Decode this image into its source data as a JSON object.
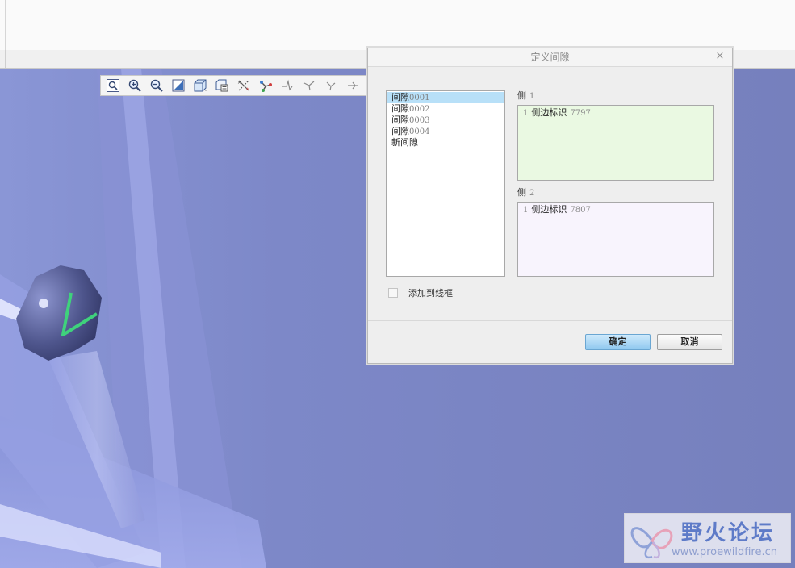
{
  "dialog": {
    "title": "定义间隙",
    "close_glyph": "×",
    "clearances": [
      {
        "prefix": "间隙",
        "num": "0001",
        "selected": true
      },
      {
        "prefix": "间隙",
        "num": "0002",
        "selected": false
      },
      {
        "prefix": "间隙",
        "num": "0003",
        "selected": false
      },
      {
        "prefix": "间隙",
        "num": "0004",
        "selected": false
      },
      {
        "prefix": "新间隙",
        "num": "",
        "selected": false
      }
    ],
    "side1": {
      "label": "侧",
      "num": "1",
      "entry_index": "1",
      "entry_text": "侧边标识",
      "entry_ref": "7797"
    },
    "side2": {
      "label": "侧",
      "num": "2",
      "entry_index": "1",
      "entry_text": "侧边标识",
      "entry_ref": "7807"
    },
    "checkbox_label": "添加到线框",
    "checkbox_checked": false,
    "ok_label": "确定",
    "cancel_label": "取消"
  },
  "toolbar": {
    "icons": [
      "zoom-fit-icon",
      "zoom-in-icon",
      "zoom-out-icon",
      "repaint-icon",
      "display-style-icon",
      "saved-views-icon",
      "datum-display-icon",
      "spin-center-icon",
      "annotation-1-icon",
      "annotation-2-icon",
      "annotation-3-icon",
      "annotation-4-icon"
    ]
  },
  "watermark": {
    "title": "野火论坛",
    "url": "www.proewildfire.cn"
  },
  "colors": {
    "viewport_bg": "#7680bd",
    "accent_blue": "#5e7bc8",
    "selection": "#b8e0f8",
    "side1_bg": "#eaf9e2",
    "side2_bg": "#f8f4fd"
  }
}
